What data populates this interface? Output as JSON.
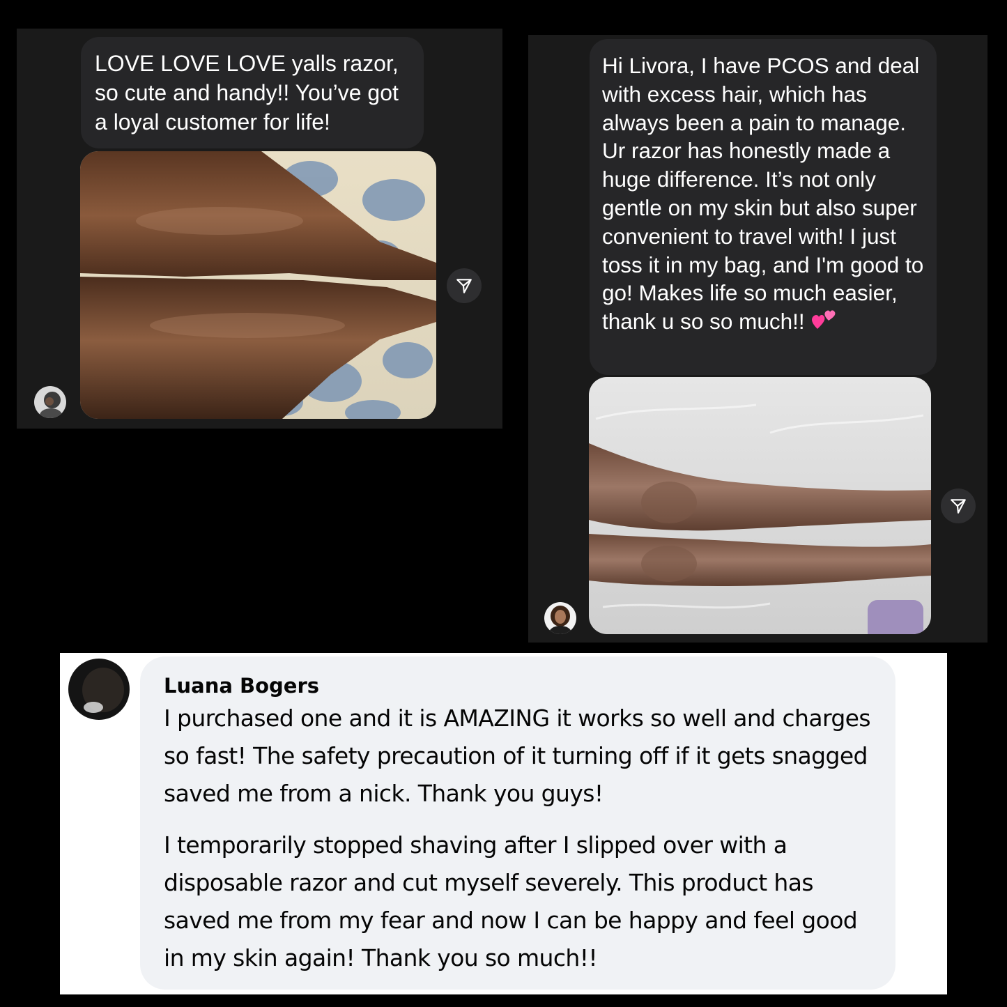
{
  "panel1": {
    "message": "LOVE LOVE LOVE yalls razor, so cute and handy!! You’ve got a loyal customer for life!"
  },
  "panel2": {
    "message": "Hi Livora, I have PCOS and deal with excess hair, which has always been a pain to manage. Ur razor has honestly made a huge difference. It’s not only gentle on my skin but also super convenient to travel with! I just toss it in my bag, and I'm good to go! Makes life so much easier, thank u so so much!!",
    "emoji": "💕"
  },
  "facebook_comment": {
    "author": "Luana Bogers",
    "paragraph1": "I purchased one and it is AMAZING it works so well and charges so fast! The safety precaution of it turning off if it gets snagged saved me from a nick. Thank you guys!",
    "paragraph2": "I temporarily stopped shaving after I slipped over with a disposable razor and cut myself severely. This product has saved me from my fear and now I can be happy and feel good in my skin again! Thank you so much!!"
  },
  "icons": {
    "share": "share-arrow-icon",
    "heart": "two-hearts-emoji"
  },
  "colors": {
    "background": "#000000",
    "dm_panel": "#1a1a1a",
    "dm_bubble": "#262628",
    "fb_bubble": "#f0f2f5",
    "heart": "#ff4fa0"
  }
}
